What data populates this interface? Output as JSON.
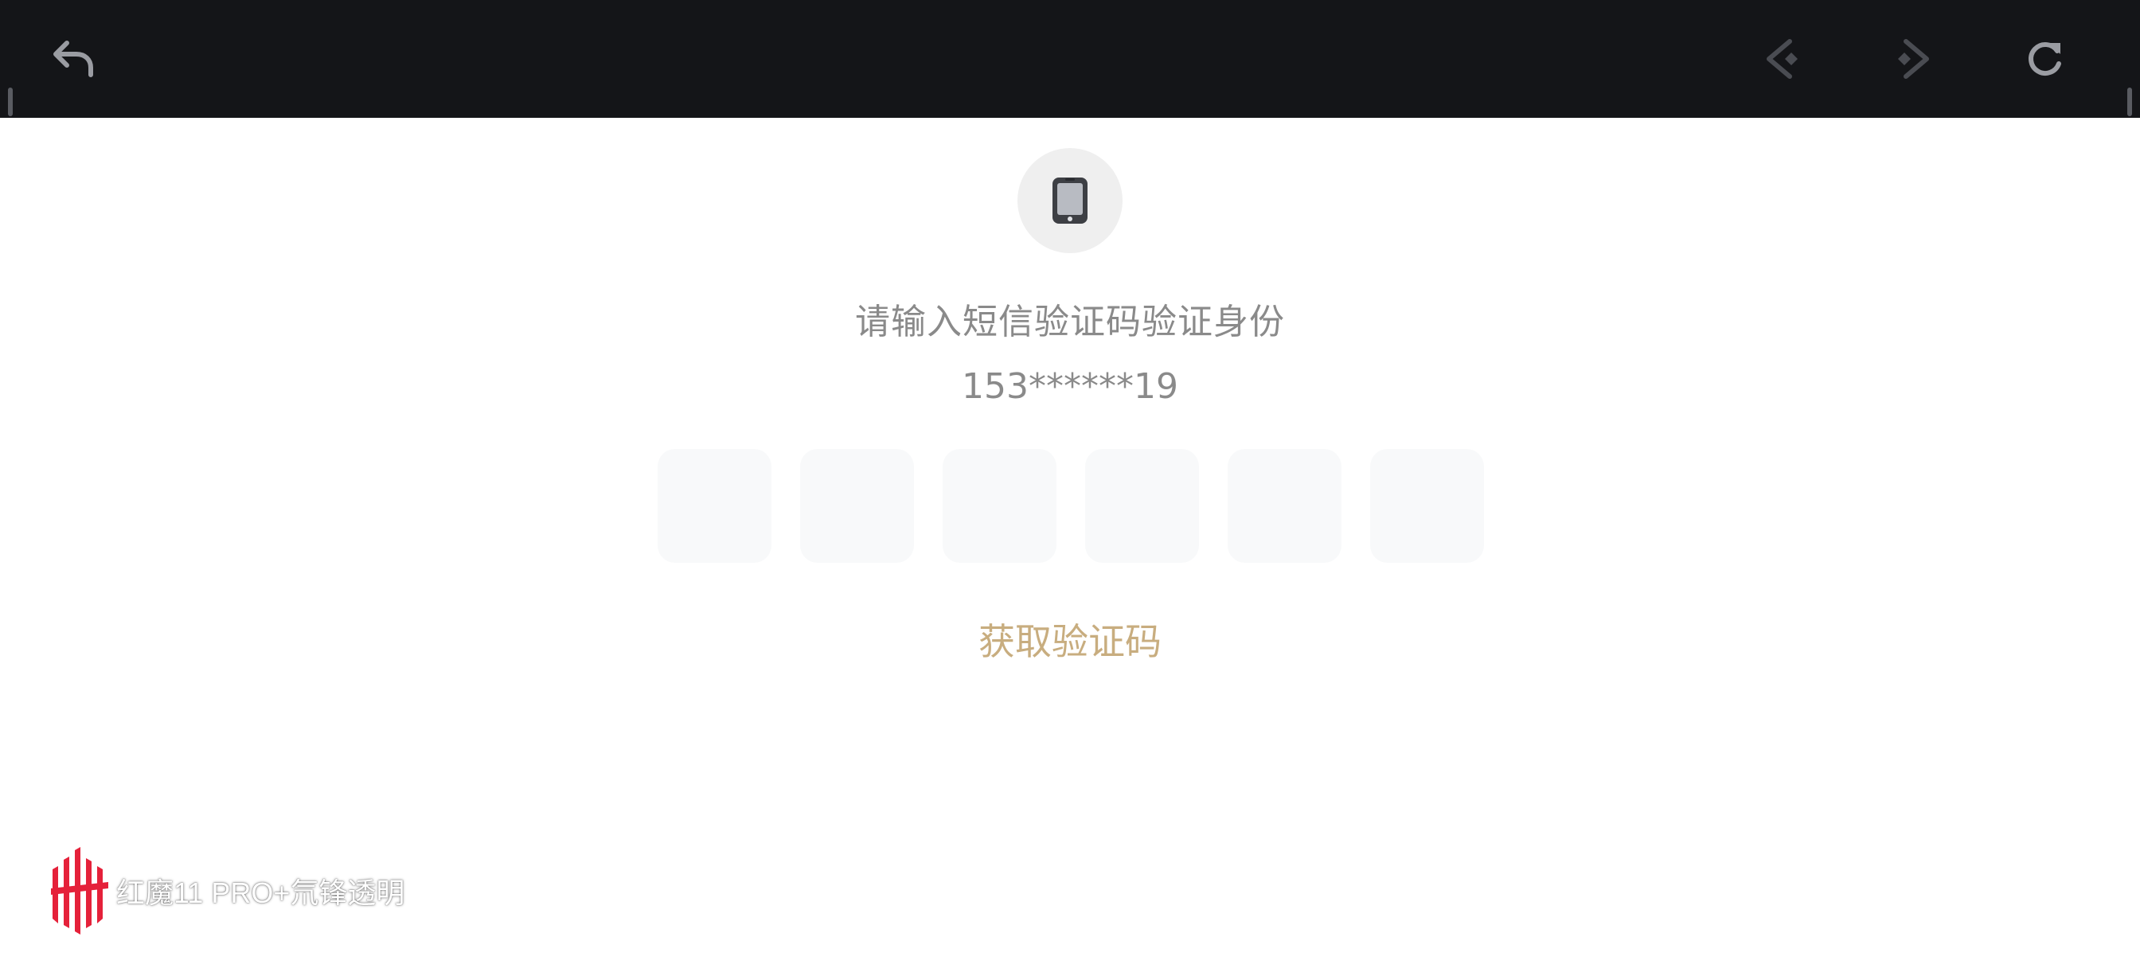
{
  "toolbar": {
    "back": "back-arrow-icon",
    "prev": "previous-icon",
    "next": "next-icon",
    "reload": "reload-icon"
  },
  "verification": {
    "icon": "phone-icon",
    "prompt": "请输入短信验证码验证身份",
    "phone_number": "153******19",
    "code_boxes": [
      "",
      "",
      "",
      "",
      "",
      ""
    ],
    "get_code_label": "获取验证码"
  },
  "watermark": {
    "text": "红魔11 PRO+氘锋透明"
  },
  "colors": {
    "top_bar": "#141518",
    "accent_gold": "#c8ad7f",
    "text_gray": "#8a8a8a",
    "code_box_bg": "#f8f9fa",
    "brand_red": "#e5213a"
  }
}
